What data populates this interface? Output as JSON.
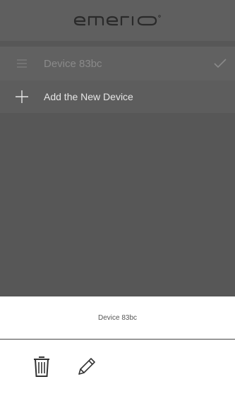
{
  "header": {
    "brand": "emerio",
    "logo_icon": "emerio-logo"
  },
  "devices": {
    "items": [
      {
        "label": "Device 83bc",
        "menu_icon": "hamburger-icon",
        "selected_icon": "check-icon",
        "selected": true
      }
    ]
  },
  "add_device": {
    "label": "Add the New Device",
    "icon": "plus-icon"
  },
  "sheet": {
    "title": "Device 83bc",
    "actions": [
      {
        "icon": "trash-icon",
        "meaning": "delete"
      },
      {
        "icon": "pencil-icon",
        "meaning": "edit"
      }
    ]
  },
  "colors": {
    "overlay_bg": "#575757",
    "header_bg": "#5f5f5f",
    "row_bg": "#616161",
    "sheet_bg": "#ffffff"
  }
}
